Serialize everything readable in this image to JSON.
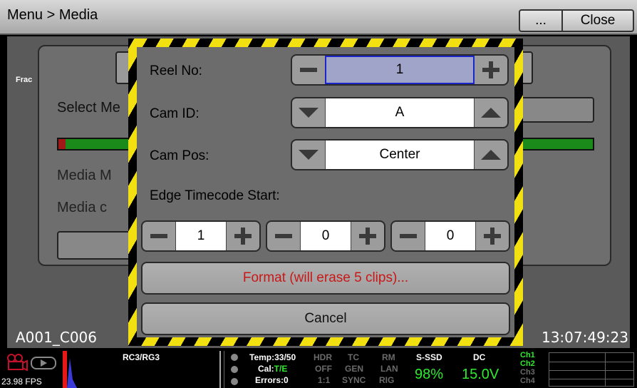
{
  "titlebar": {
    "title": "Menu > Media",
    "more_label": "...",
    "close_label": "Close"
  },
  "background": {
    "frac_text": "Frac",
    "select_label": "Select Me",
    "media_m_label": "Media M",
    "media_c_label": "Media c",
    "clip_name": "A001_C006",
    "timecode": "13:07:49:23"
  },
  "dialog": {
    "reel_no": {
      "label": "Reel No:",
      "value": "1"
    },
    "cam_id": {
      "label": "Cam ID:",
      "value": "A"
    },
    "cam_pos": {
      "label": "Cam Pos:",
      "value": "Center"
    },
    "edge_timecode": {
      "label": "Edge Timecode Start:",
      "values": [
        "1",
        "0",
        "0"
      ]
    },
    "format_label": "Format (will erase 5 clips)...",
    "cancel_label": "Cancel",
    "format_color": "#c81818"
  },
  "status": {
    "fps": "23.98 FPS",
    "rc": "RC3/RG3",
    "temp": "Temp:33/50",
    "cal_prefix": "Cal:",
    "cal_value": "T/E",
    "errors": "Errors:0",
    "hdr": [
      "HDR",
      "OFF",
      "1:1"
    ],
    "tc": [
      "TC",
      "GEN",
      "SYNC"
    ],
    "rm": [
      "RM",
      "LAN",
      "RIG"
    ],
    "media_label": "S-SSD",
    "media_value": "98%",
    "power_label": "DC",
    "power_value": "15.0V",
    "channels": [
      "Ch1",
      "Ch2",
      "Ch3",
      "Ch4"
    ]
  }
}
